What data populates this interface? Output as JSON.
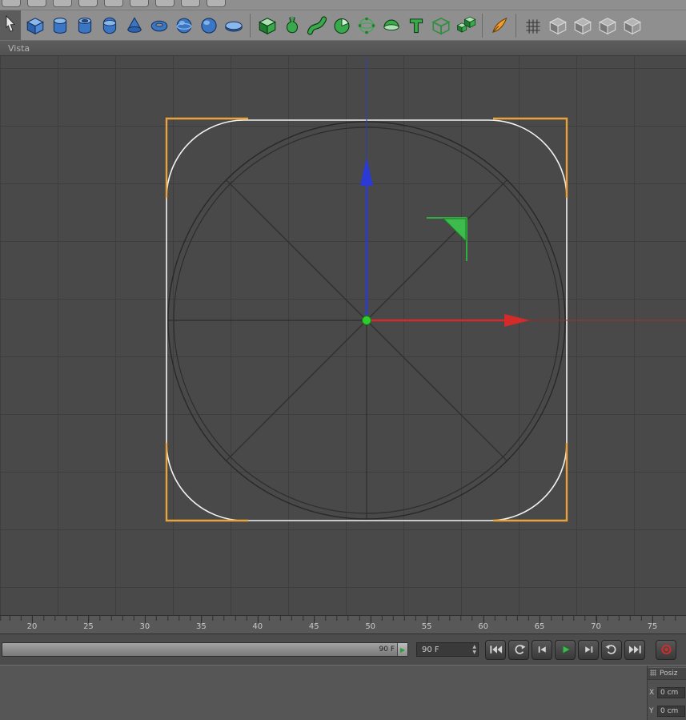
{
  "viewport": {
    "tab_label": "Vista"
  },
  "toolbar": {
    "selection_tool": "selection-cursor-icon",
    "groups": [
      {
        "name": "primitive-tools",
        "icons": [
          {
            "name": "cube-primitive-icon",
            "type": "cube"
          },
          {
            "name": "cylinder-primitive-icon",
            "type": "cylinder"
          },
          {
            "name": "tube-primitive-icon",
            "type": "tube"
          },
          {
            "name": "capsule-primitive-icon",
            "type": "capsule"
          },
          {
            "name": "cone-primitive-icon",
            "type": "cone"
          },
          {
            "name": "torus-primitive-icon",
            "type": "torus"
          },
          {
            "name": "sphere-primitive-icon",
            "type": "sphere-ring"
          },
          {
            "name": "hemisphere-primitive-icon",
            "type": "sphere"
          },
          {
            "name": "disc-primitive-icon",
            "type": "disc"
          }
        ]
      },
      {
        "name": "generator-tools",
        "icons": [
          {
            "name": "hypernurbs-icon",
            "type": "green-cube"
          },
          {
            "name": "lathe-nurbs-icon",
            "type": "vase"
          },
          {
            "name": "sweep-nurbs-icon",
            "type": "sweep"
          },
          {
            "name": "boole-icon",
            "type": "boole-sphere"
          },
          {
            "name": "ffd-deformer-icon",
            "type": "wire-sphere"
          },
          {
            "name": "symmetry-icon",
            "type": "hemisphere"
          },
          {
            "name": "text-spline-icon",
            "type": "text"
          },
          {
            "name": "instance-icon",
            "type": "cube-outline"
          },
          {
            "name": "array-icon",
            "type": "array-cubes"
          }
        ]
      },
      {
        "name": "spline-tools",
        "icons": [
          {
            "name": "spline-pen-icon",
            "type": "pen"
          }
        ]
      },
      {
        "name": "deformer-tools",
        "icons": [
          {
            "name": "grid-array-icon",
            "type": "grid"
          },
          {
            "name": "deformer-cube-icon-1",
            "type": "gray-cube"
          },
          {
            "name": "deformer-cube-icon-2",
            "type": "gray-cube"
          },
          {
            "name": "deformer-cube-icon-3",
            "type": "gray-cube"
          },
          {
            "name": "deformer-cube-icon-4",
            "type": "gray-cube"
          }
        ]
      }
    ]
  },
  "timeline": {
    "ruler_labels": [
      "20",
      "25",
      "30",
      "35",
      "40",
      "45",
      "50",
      "55",
      "60",
      "65",
      "70",
      "75"
    ],
    "range_end_label": "90 F",
    "current_frame": "90 F"
  },
  "transport": {
    "buttons": [
      {
        "name": "goto-start-button",
        "type": "skip-start"
      },
      {
        "name": "play-backwards-button",
        "type": "loop-back"
      },
      {
        "name": "step-back-button",
        "type": "step-back"
      },
      {
        "name": "play-button",
        "type": "play"
      },
      {
        "name": "step-forward-button",
        "type": "step-fwd"
      },
      {
        "name": "loop-mode-button",
        "type": "loop-fwd"
      },
      {
        "name": "goto-end-button",
        "type": "skip-end"
      },
      {
        "name": "record-button",
        "type": "record"
      }
    ]
  },
  "coordinates": {
    "panel_title": "Posiz",
    "rows": [
      {
        "axis": "X",
        "value": "0 cm"
      },
      {
        "axis": "Y",
        "value": "0 cm"
      }
    ]
  },
  "colors": {
    "axis_x": "#d42a2a",
    "axis_y": "#2b3ad4",
    "origin_green": "#2ecc2e",
    "selection_orange": "#e8a33d",
    "plane_handle_green": "#3dbb4d",
    "spline_white": "#f2f2f2",
    "viewport_bg": "#494949"
  }
}
